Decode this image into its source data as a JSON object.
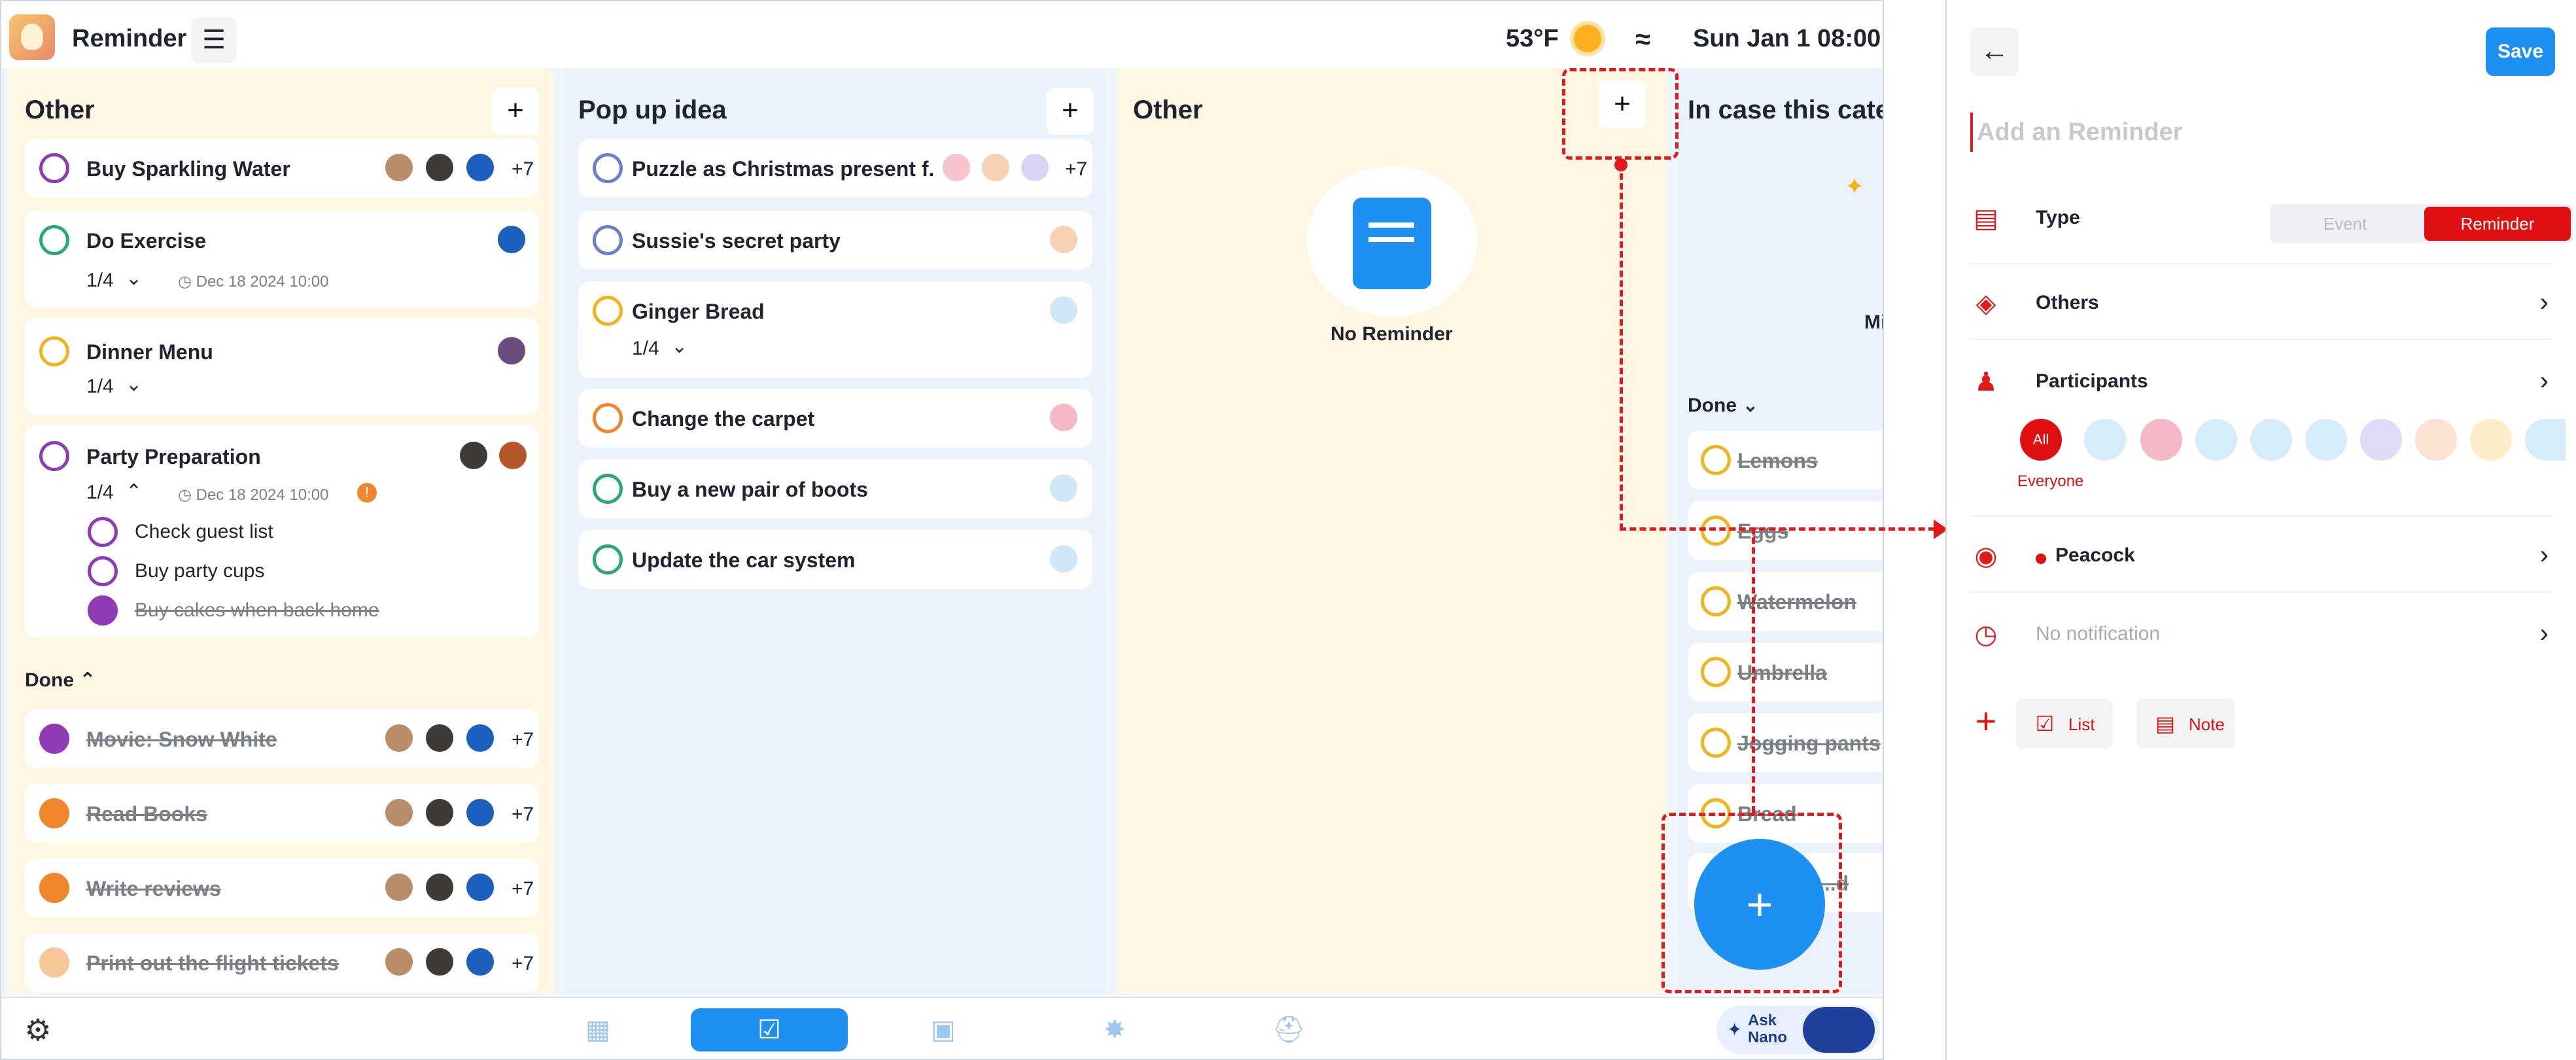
{
  "app": {
    "title": "Reminder",
    "temperature": "53°F",
    "datetime": "Sun Jan 1 08:00"
  },
  "colors": {
    "accent": "#1e90f2",
    "danger": "#e01010",
    "purple": "#8e3bb5",
    "green": "#2aa86d",
    "orange": "#f0862b",
    "yellow": "#f2b31c",
    "blue": "#6b7fd0"
  },
  "columns": [
    {
      "title": "Other",
      "cards": [
        {
          "title": "Buy Sparkling Water",
          "more": "+7",
          "ring": "purple"
        },
        {
          "title": "Do Exercise",
          "progress": "1/4",
          "due": "Dec 18 2024 10:00",
          "ring": "green"
        },
        {
          "title": "Dinner Menu",
          "progress": "1/4",
          "ring": "yellow"
        },
        {
          "title": "Party Preparation",
          "progress": "1/4",
          "due": "Dec 18 2024 10:00",
          "ring": "purple",
          "subtasks": [
            {
              "title": "Check guest list",
              "done": false
            },
            {
              "title": "Buy party cups",
              "done": false
            },
            {
              "title": "Buy cakes when back home",
              "done": true
            }
          ]
        }
      ],
      "done_label": "Done",
      "done_cards": [
        {
          "title": "Movie: Snow White",
          "more": "+7",
          "ring": "purple"
        },
        {
          "title": "Read Books",
          "more": "+7",
          "ring": "orange"
        },
        {
          "title": "Write reviews",
          "more": "+7",
          "ring": "orange"
        },
        {
          "title": "Print out the flight tickets",
          "more": "+7",
          "ring": "orange"
        }
      ]
    },
    {
      "title": "Pop up idea",
      "cards": [
        {
          "title": "Puzzle as Christmas present f...",
          "more": "+7",
          "ring": "blue"
        },
        {
          "title": "Sussie's secret party",
          "ring": "blue"
        },
        {
          "title": "Ginger Bread",
          "progress": "1/4",
          "ring": "yellow"
        },
        {
          "title": "Change the carpet",
          "ring": "orange"
        },
        {
          "title": "Buy a new pair of boots",
          "ring": "green"
        },
        {
          "title": "Update the car system",
          "ring": "green"
        }
      ]
    },
    {
      "title": "Other",
      "empty_label": "No Reminder"
    },
    {
      "title": "In case this categ",
      "partial_label": "Mi",
      "done_label": "Done",
      "done_cards": [
        "Lemons",
        "Eggs",
        "Watermelon",
        "Umbrella",
        "Jogging pants",
        "Bread",
        "...d"
      ]
    }
  ],
  "bottom_nav": {
    "items": [
      "calendar-icon",
      "checklist-icon",
      "image-icon",
      "badge-icon",
      "cart-icon"
    ],
    "active": "checklist-icon",
    "ask_nano": "Ask Nano"
  },
  "panel": {
    "save_label": "Save",
    "placeholder": "Add an Reminder",
    "type_label": "Type",
    "type_options": [
      "Event",
      "Reminder"
    ],
    "type_selected": "Reminder",
    "category_label": "Others",
    "participants_label": "Participants",
    "all_label": "All",
    "everyone_label": "Everyone",
    "tag_label": "Peacock",
    "notification_label": "No notification",
    "add_options": [
      "List",
      "Note"
    ]
  }
}
